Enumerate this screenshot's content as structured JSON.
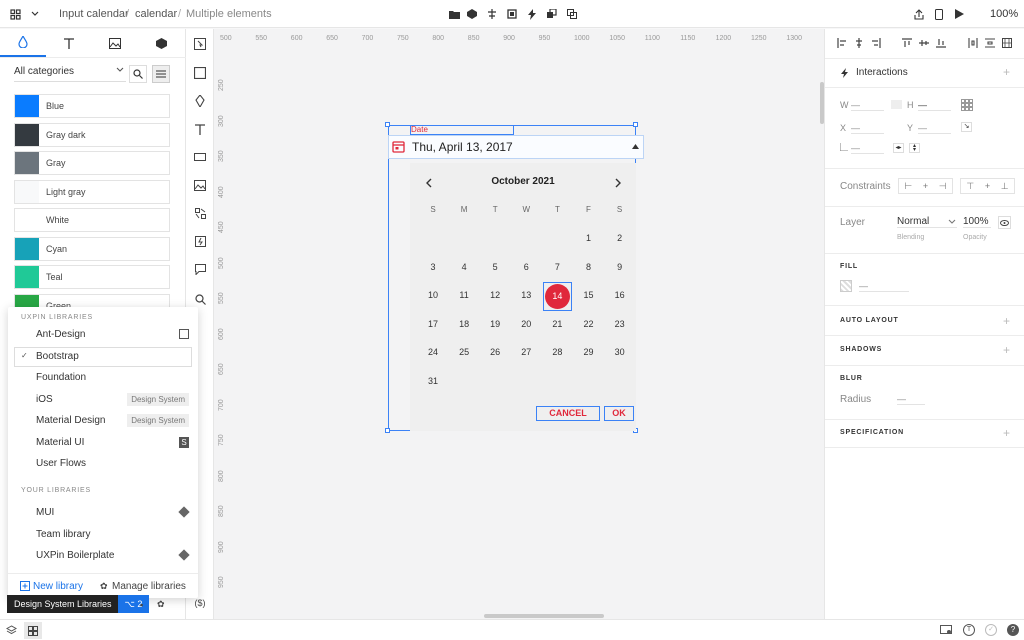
{
  "topbar": {
    "crumbs": [
      "Input calendar",
      "calendar",
      "Multiple elements"
    ],
    "zoom": "100%"
  },
  "left": {
    "category_select": "All categories",
    "swatches": [
      {
        "label": "Blue",
        "color": "#0a7cff"
      },
      {
        "label": "Gray dark",
        "color": "#343a40"
      },
      {
        "label": "Gray",
        "color": "#6c757d"
      },
      {
        "label": "Light gray",
        "color": "#f8f9fa"
      },
      {
        "label": "White",
        "color": "#ffffff"
      },
      {
        "label": "Cyan",
        "color": "#17a2b8"
      },
      {
        "label": "Teal",
        "color": "#20c997"
      },
      {
        "label": "Green",
        "color": "#28a745"
      }
    ]
  },
  "libraries": {
    "uxpin_heading": "UXPIN LIBRARIES",
    "uxpin": [
      {
        "label": "Ant-Design"
      },
      {
        "label": "Bootstrap"
      },
      {
        "label": "Foundation"
      },
      {
        "label": "iOS",
        "badge": "Design System"
      },
      {
        "label": "Material Design",
        "badge": "Design System"
      },
      {
        "label": "Material UI"
      },
      {
        "label": "User Flows"
      }
    ],
    "your_heading": "YOUR LIBRARIES",
    "yours": [
      {
        "label": "MUI"
      },
      {
        "label": "Team library"
      },
      {
        "label": "UXPin Boilerplate"
      }
    ],
    "new_library": "New library",
    "manage_libraries": "Manage libraries",
    "tooltip": "Design System Libraries",
    "tooltip_shortcut": "⌥ 2"
  },
  "ruler_x": [
    "500",
    "550",
    "600",
    "650",
    "700",
    "750",
    "800",
    "850",
    "900",
    "950",
    "1000",
    "1050",
    "1100",
    "1150",
    "1200",
    "1250",
    "1300"
  ],
  "ruler_y": [
    "250",
    "300",
    "350",
    "400",
    "450",
    "500",
    "550",
    "600",
    "650",
    "700",
    "750",
    "800",
    "850",
    "900",
    "950"
  ],
  "calendar": {
    "field_label": "Date",
    "field_value": "Thu, April 13, 2017",
    "month": "October 2021",
    "weekdays": [
      "S",
      "M",
      "T",
      "W",
      "T",
      "F",
      "S"
    ],
    "rows": [
      [
        "",
        "",
        "",
        "",
        "",
        "1",
        "2"
      ],
      [
        "3",
        "4",
        "5",
        "6",
        "7",
        "8",
        "9"
      ],
      [
        "10",
        "11",
        "12",
        "13",
        "14",
        "15",
        "16"
      ],
      [
        "17",
        "18",
        "19",
        "20",
        "21",
        "22",
        "23"
      ],
      [
        "24",
        "25",
        "26",
        "27",
        "28",
        "29",
        "30"
      ],
      [
        "31",
        "",
        "",
        "",
        "",
        "",
        ""
      ]
    ],
    "selected": "14",
    "cancel": "CANCEL",
    "ok": "OK",
    "accent": "#e0283b"
  },
  "right": {
    "interactions": "Interactions",
    "w": "W",
    "h": "H",
    "x": "X",
    "y": "Y",
    "dash": "—",
    "constraints": "Constraints",
    "layer": "Layer",
    "blend_mode": "Normal",
    "blending": "Blending",
    "opacity": "100%",
    "opacity_label": "Opacity",
    "fill": "FILL",
    "auto_layout": "AUTO LAYOUT",
    "shadows": "SHADOWS",
    "blur": "BLUR",
    "radius": "Radius",
    "specification": "SPECIFICATION"
  }
}
